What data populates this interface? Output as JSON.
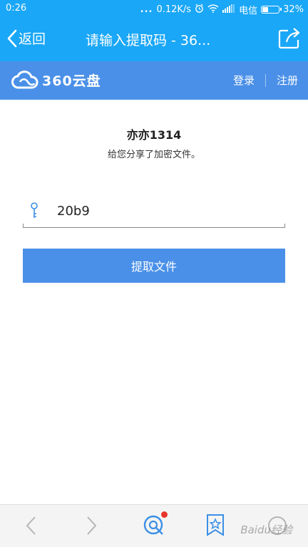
{
  "status_bar": {
    "time": "0:26",
    "dots": "...",
    "speed": "0.12K/s",
    "carrier": "电信",
    "battery": "32%",
    "battery_level": 0.32
  },
  "header": {
    "back_label": "返回",
    "title": "请输入提取码 - 36..."
  },
  "brand": {
    "logo_text": "360云盘",
    "login": "登录",
    "register": "注册"
  },
  "share": {
    "sharer_name": "亦亦1314",
    "description": "给您分享了加密文件。"
  },
  "code_input": {
    "value": "20b9"
  },
  "extract_button": "提取文件",
  "watermark": "Baidu经验",
  "colors": {
    "header_blue": "#1aa7f7",
    "brand_blue": "#4a90e8",
    "badge_red": "#e8352c"
  }
}
